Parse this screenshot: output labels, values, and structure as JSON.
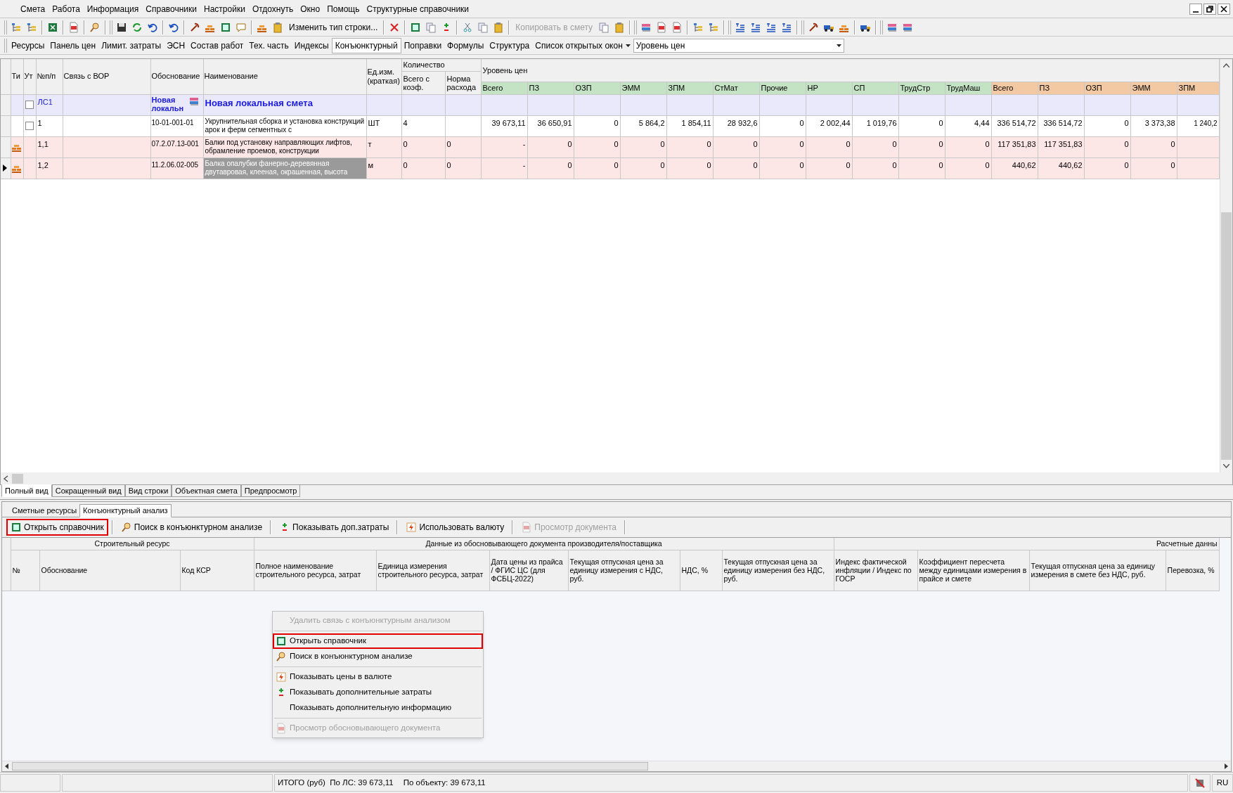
{
  "menu": [
    "Смета",
    "Работа",
    "Информация",
    "Справочники",
    "Настройки",
    "Отдохнуть",
    "Окно",
    "Помощь",
    "Структурные справочники"
  ],
  "toolbar_buttons": [
    {
      "label": "Изменить тип строки...",
      "disabled": false
    },
    {
      "label": "Копировать в смету",
      "disabled": true
    }
  ],
  "view_tabs": [
    {
      "label": "Ресурсы",
      "selected": false
    },
    {
      "label": "Панель цен",
      "selected": false
    },
    {
      "label": "Лимит. затраты",
      "selected": false
    },
    {
      "label": "ЭСН",
      "selected": false
    },
    {
      "label": "Состав работ",
      "selected": false
    },
    {
      "label": "Тех. часть",
      "selected": false
    },
    {
      "label": "Индексы",
      "selected": false
    },
    {
      "label": "Конъюнктурный",
      "selected": true
    },
    {
      "label": "Поправки",
      "selected": false
    },
    {
      "label": "Формулы",
      "selected": false
    },
    {
      "label": "Структура",
      "selected": false
    }
  ],
  "open_windows_menu": "Список открытых окон",
  "price_level_combo": "Уровень цен",
  "grid": {
    "columns": [
      "Ти",
      "Ут",
      "№п/п",
      "Связь с ВОР",
      "Обоснование",
      "Наименование",
      "Ед.изм. (краткая)"
    ],
    "quantity_group": "Количество",
    "quantity_columns": [
      "Всего с коэф.",
      "Норма расхода"
    ],
    "price_group": "Уровень цен",
    "price_columns": [
      {
        "label": "Всего",
        "color": "#c4e3c4"
      },
      {
        "label": "ПЗ",
        "color": "#c4e3c4"
      },
      {
        "label": "ОЗП",
        "color": "#c4e3c4"
      },
      {
        "label": "ЭММ",
        "color": "#c4e3c4"
      },
      {
        "label": "ЗПМ",
        "color": "#c4e3c4"
      },
      {
        "label": "СтМат",
        "color": "#c4e3c4"
      },
      {
        "label": "Прочие",
        "color": "#c4e3c4"
      },
      {
        "label": "НР",
        "color": "#c4e3c4"
      },
      {
        "label": "СП",
        "color": "#c4e3c4"
      },
      {
        "label": "ТрудСтр",
        "color": "#c4e3c4"
      },
      {
        "label": "ТрудМаш",
        "color": "#c4e3c4"
      },
      {
        "label": "Всего",
        "color": "#f3c9a3"
      },
      {
        "label": "ПЗ",
        "color": "#f3c9a3"
      },
      {
        "label": "ОЗП",
        "color": "#f3c9a3"
      },
      {
        "label": "ЭММ",
        "color": "#f3c9a3"
      },
      {
        "label": "ЗПМ",
        "color": "#f3c9a3"
      }
    ],
    "rows": [
      {
        "kind": "section",
        "selected": false,
        "checked": false,
        "number": "ЛС1",
        "basis": "Новая локальн",
        "name": "Новая локальная смета"
      },
      {
        "kind": "work",
        "selected": false,
        "checked": false,
        "number": "1",
        "basis": "10-01-001-01",
        "name": "Укрупнительная сборка и установка конструкций арок и ферм сегментных с",
        "unit": "ШТ",
        "total_qty": "4",
        "prices": [
          "39 673,11",
          "36 650,91",
          "0",
          "5 864,2",
          "1 854,11",
          "28 932,6",
          "0",
          "2 002,44",
          "1 019,76",
          "0",
          "4,44",
          "336 514,72",
          "336 514,72",
          "0",
          "3 373,38",
          "1 240,2"
        ]
      },
      {
        "kind": "resource",
        "selected": false,
        "number": "1,1",
        "basis": "07.2.07.13-001",
        "name": "Балки под установку направляющих лифтов, обрамление проемов, конструкции",
        "unit": "т",
        "total_qty": "0",
        "norm": "0",
        "prices": [
          "-",
          "0",
          "0",
          "0",
          "0",
          "0",
          "0",
          "0",
          "0",
          "0",
          "0",
          "117 351,83",
          "117 351,83",
          "0",
          "0"
        ]
      },
      {
        "kind": "resource",
        "selected": true,
        "number": "1,2",
        "basis": "11.2.06.02-005",
        "name": "Балка опалубки фанерно-деревянная двутавровая, клееная, окрашенная, высота",
        "unit": "м",
        "total_qty": "0",
        "norm": "0",
        "prices": [
          "-",
          "0",
          "0",
          "0",
          "0",
          "0",
          "0",
          "0",
          "0",
          "0",
          "0",
          "440,62",
          "440,62",
          "0",
          "0"
        ]
      }
    ]
  },
  "bottom_tabs": [
    {
      "label": "Полный вид",
      "selected": true
    },
    {
      "label": "Сокращенный вид",
      "selected": false
    },
    {
      "label": "Вид строки",
      "selected": false
    },
    {
      "label": "Объектная смета",
      "selected": false
    },
    {
      "label": "Предпросмотр",
      "selected": false
    }
  ],
  "panel_tabs": [
    {
      "label": "Сметные ресурсы",
      "selected": false
    },
    {
      "label": "Конъюнктурный анализ",
      "selected": true
    }
  ],
  "panel_toolbar": [
    {
      "label": "Открыть справочник",
      "disabled": false,
      "highlighted": true
    },
    {
      "label": "Поиск в конъюнктурном анализе",
      "disabled": false,
      "highlighted": false
    },
    {
      "label": "Показывать доп.затраты",
      "disabled": false,
      "highlighted": false
    },
    {
      "label": "Использовать валюту",
      "disabled": false,
      "highlighted": false
    },
    {
      "label": "Просмотр документа",
      "disabled": true,
      "highlighted": false
    }
  ],
  "analysis_table": {
    "groups": [
      "Строительный ресурс",
      "Данные из обосновывающего документа производителя/поставщика",
      "Расчетные данны"
    ],
    "columns": [
      "№",
      "Обоснование",
      "Код КСР",
      "Полное наименование строительного ресурса, затрат",
      "Единица измерения строительного ресурса, затрат",
      "Дата цены из прайса / ФГИС ЦС (для ФСБЦ-2022)",
      "Текущая отпускная цена за единицу измерения с НДС, руб.",
      "НДС, %",
      "Текущая отпускная цена за единицу измерения без НДС, руб.",
      "Индекс фактической инфляции /  Индекс по  ГОСР",
      "Коэффициент пересчета между единицами измерения в прайсе и смете",
      "Текущая отпускная цена за единицу измерения в смете без НДС, руб.",
      "Перевозка, %"
    ]
  },
  "context_menu": [
    {
      "kind": "item",
      "label": "Удалить связь с конъюнктурным анализом",
      "disabled": true,
      "highlighted": false
    },
    {
      "kind": "separator"
    },
    {
      "kind": "item",
      "label": "Открыть справочник",
      "disabled": false,
      "highlighted": true
    },
    {
      "kind": "item",
      "label": "Поиск в конъюнктурном анализе",
      "disabled": false,
      "highlighted": false
    },
    {
      "kind": "separator"
    },
    {
      "kind": "item",
      "label": "Показывать цены в валюте",
      "disabled": false,
      "highlighted": false
    },
    {
      "kind": "item",
      "label": "Показывать дополнительные затраты",
      "disabled": false,
      "highlighted": false
    },
    {
      "kind": "item",
      "label": "Показывать дополнительную информацию",
      "disabled": false,
      "highlighted": false
    },
    {
      "kind": "separator"
    },
    {
      "kind": "item",
      "label": "Просмотр обосновывающего документа",
      "disabled": true,
      "highlighted": false
    }
  ],
  "status_bar": {
    "total": "ИТОГО (руб)  По ЛС: 39 673,11",
    "object_total": "По объекту: 39 673,11",
    "language": "RU"
  }
}
